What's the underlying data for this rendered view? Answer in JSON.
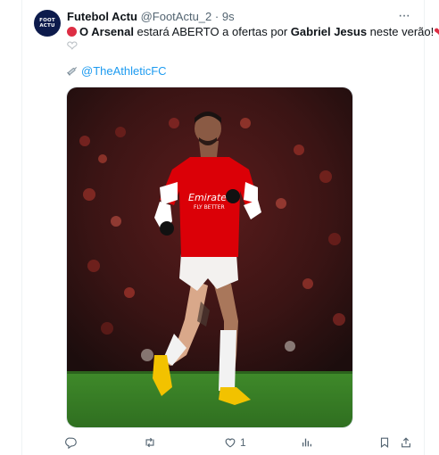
{
  "tweet": {
    "author_name": "Futebol Actu",
    "author_handle": "@FootActu_2",
    "separator": "·",
    "time": "9s",
    "avatar_text_top": "FOOT",
    "avatar_text_bottom": "ACTU",
    "text": {
      "part1_bold": "O Arsenal",
      "part2": " estará ABERTO a ofertas por ",
      "part3_bold": "Gabriel Jesus",
      "part4": " neste verão!",
      "source_mention": "@TheAthleticFC"
    },
    "image_alt": "Gabriel Jesus playing for Arsenal",
    "jersey_text_top": "Emirates",
    "jersey_text_bottom": "FLY BETTER",
    "actions": {
      "reply_count": "",
      "retweet_count": "",
      "like_count": "1",
      "views_count": ""
    }
  },
  "colors": {
    "link": "#1d9bf0",
    "muted": "#536471",
    "heart": "#dd2e44",
    "arsenal_red": "#db0007"
  },
  "icons": [
    "more-icon",
    "red-circle-icon",
    "red-heart-icon",
    "white-heart-icon",
    "syringe-icon",
    "reply-icon",
    "retweet-icon",
    "like-icon",
    "views-icon",
    "bookmark-icon",
    "share-icon"
  ]
}
